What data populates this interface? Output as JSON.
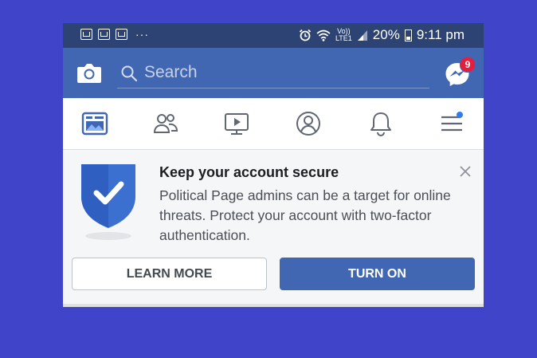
{
  "status_bar": {
    "net_top": "Vo))",
    "net_bottom": "LTE1",
    "battery": "20%",
    "time": "9:11 pm",
    "dots": "···"
  },
  "header": {
    "search_placeholder": "Search",
    "messenger_badge": "9"
  },
  "tabs": [
    {
      "name": "news-feed",
      "active": true
    },
    {
      "name": "friends"
    },
    {
      "name": "watch"
    },
    {
      "name": "profile"
    },
    {
      "name": "notifications"
    },
    {
      "name": "menu"
    }
  ],
  "card": {
    "title": "Keep your account secure",
    "body": "Political Page admins can be a target for online threats. Protect your account with two-factor authentication.",
    "learn_more": "LEARN MORE",
    "turn_on": "TURN ON"
  },
  "colors": {
    "background": "#3f44c8",
    "fb_blue": "#4267b2",
    "status_bar": "#2d4373",
    "shield": "#3b6fd0"
  }
}
